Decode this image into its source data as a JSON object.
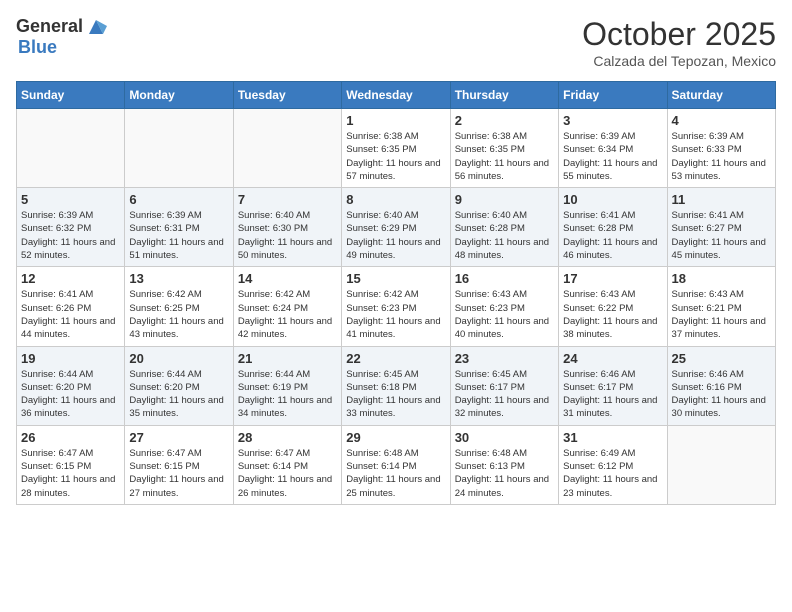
{
  "header": {
    "logo_general": "General",
    "logo_blue": "Blue",
    "month": "October 2025",
    "location": "Calzada del Tepozan, Mexico"
  },
  "days_of_week": [
    "Sunday",
    "Monday",
    "Tuesday",
    "Wednesday",
    "Thursday",
    "Friday",
    "Saturday"
  ],
  "weeks": [
    [
      {
        "num": "",
        "info": ""
      },
      {
        "num": "",
        "info": ""
      },
      {
        "num": "",
        "info": ""
      },
      {
        "num": "1",
        "info": "Sunrise: 6:38 AM\nSunset: 6:35 PM\nDaylight: 11 hours and 57 minutes."
      },
      {
        "num": "2",
        "info": "Sunrise: 6:38 AM\nSunset: 6:35 PM\nDaylight: 11 hours and 56 minutes."
      },
      {
        "num": "3",
        "info": "Sunrise: 6:39 AM\nSunset: 6:34 PM\nDaylight: 11 hours and 55 minutes."
      },
      {
        "num": "4",
        "info": "Sunrise: 6:39 AM\nSunset: 6:33 PM\nDaylight: 11 hours and 53 minutes."
      }
    ],
    [
      {
        "num": "5",
        "info": "Sunrise: 6:39 AM\nSunset: 6:32 PM\nDaylight: 11 hours and 52 minutes."
      },
      {
        "num": "6",
        "info": "Sunrise: 6:39 AM\nSunset: 6:31 PM\nDaylight: 11 hours and 51 minutes."
      },
      {
        "num": "7",
        "info": "Sunrise: 6:40 AM\nSunset: 6:30 PM\nDaylight: 11 hours and 50 minutes."
      },
      {
        "num": "8",
        "info": "Sunrise: 6:40 AM\nSunset: 6:29 PM\nDaylight: 11 hours and 49 minutes."
      },
      {
        "num": "9",
        "info": "Sunrise: 6:40 AM\nSunset: 6:28 PM\nDaylight: 11 hours and 48 minutes."
      },
      {
        "num": "10",
        "info": "Sunrise: 6:41 AM\nSunset: 6:28 PM\nDaylight: 11 hours and 46 minutes."
      },
      {
        "num": "11",
        "info": "Sunrise: 6:41 AM\nSunset: 6:27 PM\nDaylight: 11 hours and 45 minutes."
      }
    ],
    [
      {
        "num": "12",
        "info": "Sunrise: 6:41 AM\nSunset: 6:26 PM\nDaylight: 11 hours and 44 minutes."
      },
      {
        "num": "13",
        "info": "Sunrise: 6:42 AM\nSunset: 6:25 PM\nDaylight: 11 hours and 43 minutes."
      },
      {
        "num": "14",
        "info": "Sunrise: 6:42 AM\nSunset: 6:24 PM\nDaylight: 11 hours and 42 minutes."
      },
      {
        "num": "15",
        "info": "Sunrise: 6:42 AM\nSunset: 6:23 PM\nDaylight: 11 hours and 41 minutes."
      },
      {
        "num": "16",
        "info": "Sunrise: 6:43 AM\nSunset: 6:23 PM\nDaylight: 11 hours and 40 minutes."
      },
      {
        "num": "17",
        "info": "Sunrise: 6:43 AM\nSunset: 6:22 PM\nDaylight: 11 hours and 38 minutes."
      },
      {
        "num": "18",
        "info": "Sunrise: 6:43 AM\nSunset: 6:21 PM\nDaylight: 11 hours and 37 minutes."
      }
    ],
    [
      {
        "num": "19",
        "info": "Sunrise: 6:44 AM\nSunset: 6:20 PM\nDaylight: 11 hours and 36 minutes."
      },
      {
        "num": "20",
        "info": "Sunrise: 6:44 AM\nSunset: 6:20 PM\nDaylight: 11 hours and 35 minutes."
      },
      {
        "num": "21",
        "info": "Sunrise: 6:44 AM\nSunset: 6:19 PM\nDaylight: 11 hours and 34 minutes."
      },
      {
        "num": "22",
        "info": "Sunrise: 6:45 AM\nSunset: 6:18 PM\nDaylight: 11 hours and 33 minutes."
      },
      {
        "num": "23",
        "info": "Sunrise: 6:45 AM\nSunset: 6:17 PM\nDaylight: 11 hours and 32 minutes."
      },
      {
        "num": "24",
        "info": "Sunrise: 6:46 AM\nSunset: 6:17 PM\nDaylight: 11 hours and 31 minutes."
      },
      {
        "num": "25",
        "info": "Sunrise: 6:46 AM\nSunset: 6:16 PM\nDaylight: 11 hours and 30 minutes."
      }
    ],
    [
      {
        "num": "26",
        "info": "Sunrise: 6:47 AM\nSunset: 6:15 PM\nDaylight: 11 hours and 28 minutes."
      },
      {
        "num": "27",
        "info": "Sunrise: 6:47 AM\nSunset: 6:15 PM\nDaylight: 11 hours and 27 minutes."
      },
      {
        "num": "28",
        "info": "Sunrise: 6:47 AM\nSunset: 6:14 PM\nDaylight: 11 hours and 26 minutes."
      },
      {
        "num": "29",
        "info": "Sunrise: 6:48 AM\nSunset: 6:14 PM\nDaylight: 11 hours and 25 minutes."
      },
      {
        "num": "30",
        "info": "Sunrise: 6:48 AM\nSunset: 6:13 PM\nDaylight: 11 hours and 24 minutes."
      },
      {
        "num": "31",
        "info": "Sunrise: 6:49 AM\nSunset: 6:12 PM\nDaylight: 11 hours and 23 minutes."
      },
      {
        "num": "",
        "info": ""
      }
    ]
  ]
}
